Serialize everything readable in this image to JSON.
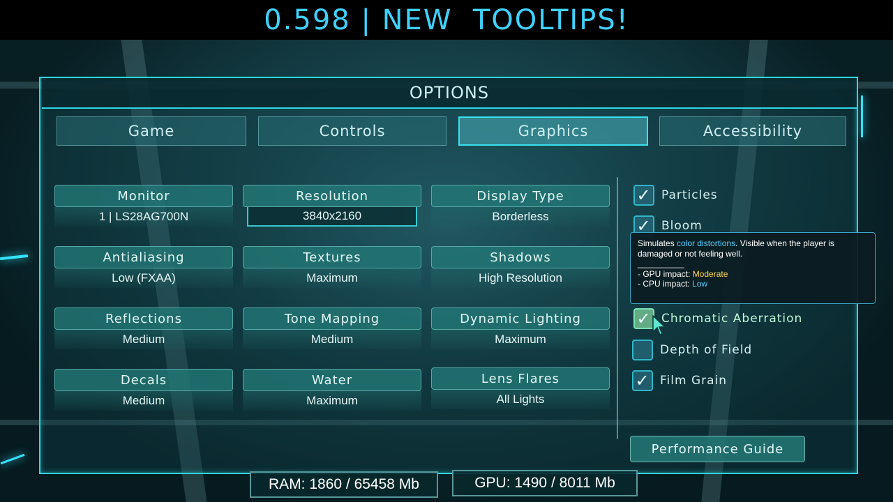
{
  "banner": {
    "text": "0.598 | NEW  TOOLTIPS!"
  },
  "menu": {
    "title": "OPTIONS",
    "tabs": [
      {
        "label": "Game"
      },
      {
        "label": "Controls"
      },
      {
        "label": "Graphics",
        "active": true
      },
      {
        "label": "Accessibility"
      }
    ]
  },
  "settings": [
    {
      "label": "Monitor",
      "value": "1 | LS28AG700N"
    },
    {
      "label": "Resolution",
      "value": "3840x2160"
    },
    {
      "label": "Display Type",
      "value": "Borderless"
    },
    {
      "label": "Antialiasing",
      "value": "Low (FXAA)"
    },
    {
      "label": "Textures",
      "value": "Maximum"
    },
    {
      "label": "Shadows",
      "value": "High Resolution"
    },
    {
      "label": "Reflections",
      "value": "Medium"
    },
    {
      "label": "Tone Mapping",
      "value": "Medium"
    },
    {
      "label": "Dynamic Lighting",
      "value": "Maximum"
    },
    {
      "label": "Decals",
      "value": "Medium"
    },
    {
      "label": "Water",
      "value": "Maximum"
    },
    {
      "label": "Lens Flares",
      "value": "All Lights"
    }
  ],
  "checkboxes": [
    {
      "label": "Particles",
      "checked": true
    },
    {
      "label": "Bloom",
      "checked": true
    },
    {
      "label": "Chromatic Aberration",
      "checked": true
    },
    {
      "label": "Depth of Field",
      "checked": false
    },
    {
      "label": "Film Grain",
      "checked": true
    }
  ],
  "tooltip": {
    "line1_pre": "Simulates ",
    "line1_highlight": "color distortions",
    "line1_post": ". Visible when the player is damaged or not feeling well.",
    "separator": "__________",
    "gpu_label": "- GPU impact: ",
    "gpu_value": "Moderate",
    "cpu_label": "- CPU impact: ",
    "cpu_value": "Low"
  },
  "performance_button": {
    "label": "Performance Guide"
  },
  "stats": {
    "ram": "RAM: 1860 / 65458 Mb",
    "gpu": "GPU: 1490 / 8011 Mb"
  },
  "colors": {
    "accent": "#2fd6e6",
    "banner_text": "#3fd2ff",
    "moderate": "#ffd94a",
    "low": "#4fd2ff"
  },
  "icons": {
    "checkmark": "check-icon",
    "cursor": "mouse-cursor-icon"
  }
}
